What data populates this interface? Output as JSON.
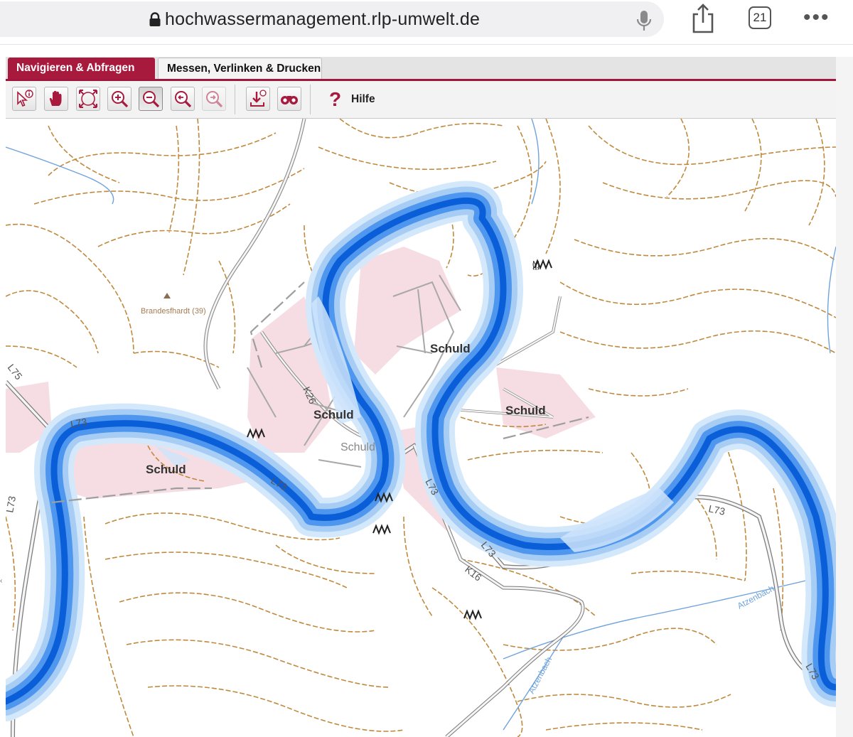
{
  "browser": {
    "url": "hochwassermanagement.rlp-umwelt.de",
    "tab_count": "21",
    "icons": [
      "lock-icon",
      "microphone-icon",
      "share-icon",
      "tabs-icon",
      "more-icon"
    ]
  },
  "app": {
    "tabs": [
      {
        "label": "Navigieren & Abfragen",
        "active": true
      },
      {
        "label": "Messen, Verlinken & Drucken",
        "active": false
      }
    ],
    "toolbar": {
      "tools": [
        "info-arrow-icon",
        "pan-hand-icon",
        "full-extent-icon",
        "zoom-in-icon",
        "zoom-out-icon",
        "zoom-previous-icon",
        "zoom-next-icon",
        "download-icon",
        "binoculars-icon"
      ],
      "pressed_tool": "zoom-out-icon",
      "help_label": "Hilfe",
      "help_symbol": "?"
    },
    "accent_color": "#a81a3d"
  },
  "map": {
    "place_labels": [
      "Schuld",
      "Schuld",
      "Schuld",
      "Schuld",
      "Schuld"
    ],
    "road_labels": [
      "L73",
      "L73",
      "L73",
      "L73",
      "L73",
      "L73",
      "L75",
      "K26",
      "K16"
    ],
    "stream_labels": [
      "Atzenbach",
      "Atzenbach"
    ],
    "poi_label": "Brandesfhardt (39)",
    "colors": {
      "flood_deep": "#0a5fd8",
      "flood_mid": "#4f97ee",
      "flood_light": "#a8cdf5",
      "flood_pale": "#d3e8fb",
      "contour": "#c08a3e",
      "road": "#9b9b9b",
      "settlement": "#f6dde3",
      "stream": "#6fa3dd"
    }
  }
}
